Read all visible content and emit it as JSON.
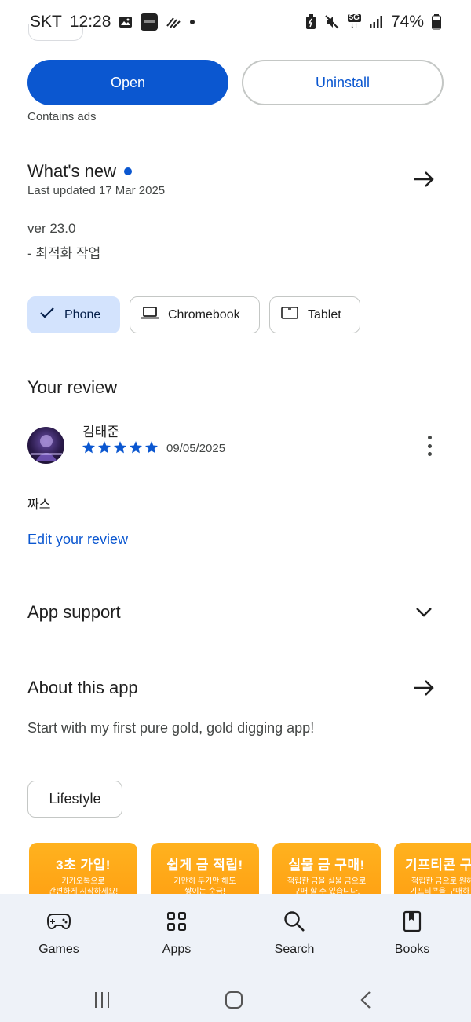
{
  "status_bar": {
    "carrier": "SKT",
    "time": "12:28",
    "network": "5G",
    "battery": "74%"
  },
  "actions": {
    "open_label": "Open",
    "uninstall_label": "Uninstall",
    "contains_ads": "Contains ads"
  },
  "whats_new": {
    "title": "What's new",
    "last_updated": "Last updated 17 Mar 2025",
    "version": "ver 23.0",
    "note": "- 최적화 작업"
  },
  "device_chips": [
    {
      "label": "Phone",
      "icon": "check-icon",
      "selected": true
    },
    {
      "label": "Chromebook",
      "icon": "laptop-icon",
      "selected": false
    },
    {
      "label": "Tablet",
      "icon": "tablet-icon",
      "selected": false
    }
  ],
  "review": {
    "section_title": "Your review",
    "reviewer": "김태준",
    "rating": 5,
    "date": "09/05/2025",
    "text": "짜스",
    "edit_label": "Edit your review"
  },
  "app_support": {
    "title": "App support"
  },
  "about": {
    "title": "About this app",
    "description": "Start with my first pure gold, gold digging app!",
    "category": "Lifestyle"
  },
  "screenshots": [
    {
      "title": "3초 가입!",
      "line1": "카카오톡으로",
      "line2": "간편하게 시작하세요!"
    },
    {
      "title": "쉽게 금 적립!",
      "line1": "가만히 두기만 해도",
      "line2": "쌓이는 순금!"
    },
    {
      "title": "실물 금 구매!",
      "line1": "적립한 금을 실물 금으로",
      "line2": "구매 할 수 있습니다."
    },
    {
      "title": "기프티콘 구",
      "line1": "적립한 금으로 원하",
      "line2": "기프티콘을 구매하"
    }
  ],
  "bottom_nav": [
    {
      "label": "Games",
      "icon": "gamepad-icon"
    },
    {
      "label": "Apps",
      "icon": "apps-grid-icon"
    },
    {
      "label": "Search",
      "icon": "search-icon"
    },
    {
      "label": "Books",
      "icon": "book-icon"
    }
  ],
  "colors": {
    "accent": "#0b57d0",
    "chip_selected": "#d3e3fd",
    "nav_bg": "#eef2f8",
    "screenshot_orange": "#ffa617"
  }
}
